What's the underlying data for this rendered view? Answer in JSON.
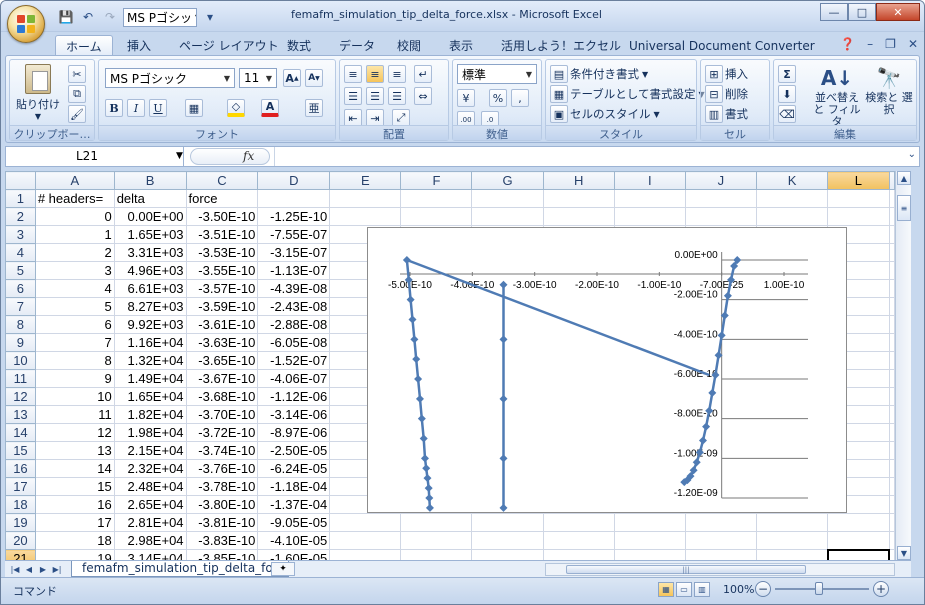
{
  "window": {
    "title": "femafm_simulation_tip_delta_force.xlsx - Microsoft Excel",
    "minimize": "—",
    "maximize": "□",
    "close": "✕"
  },
  "qat": {
    "font_value": "MS Pゴシッ"
  },
  "tabs": [
    "ホーム",
    "挿入",
    "ページ レイアウト",
    "数式",
    "データ",
    "校閲",
    "表示",
    "活用しよう！エクセル",
    "Universal Document Converter"
  ],
  "ribbon": {
    "clipboard": {
      "label": "クリップボー…",
      "paste": "貼り付け"
    },
    "font": {
      "label": "フォント",
      "name": "MS Pゴシック",
      "size": "11"
    },
    "alignment": {
      "label": "配置"
    },
    "number": {
      "label": "数値",
      "format": "標準",
      "percent": "%"
    },
    "styles": {
      "label": "スタイル",
      "conditional": "条件付き書式",
      "table": "テーブルとして書式設定",
      "cell_style": "セルのスタイル"
    },
    "cells": {
      "label": "セル",
      "insert": "挿入",
      "delete": "削除",
      "format": "書式"
    },
    "editing": {
      "label": "編集",
      "sort": "並べ替えと フィルタ",
      "find": "検索と 選択"
    }
  },
  "formula_bar": {
    "name_box": "L21",
    "fx": "fx",
    "content": ""
  },
  "sheet": {
    "columns": [
      "A",
      "B",
      "C",
      "D",
      "E",
      "F",
      "G",
      "H",
      "I",
      "J",
      "K",
      "L"
    ],
    "selected_column": "L",
    "selected_row": "21",
    "rows": [
      {
        "n": "1",
        "cells": [
          "# headers=",
          "delta",
          "force",
          ""
        ]
      },
      {
        "n": "2",
        "cells": [
          "0",
          "0.00E+00",
          "-3.50E-10",
          "-1.25E-10"
        ]
      },
      {
        "n": "3",
        "cells": [
          "1",
          "1.65E+03",
          "-3.51E-10",
          "-7.55E-07"
        ]
      },
      {
        "n": "4",
        "cells": [
          "2",
          "3.31E+03",
          "-3.53E-10",
          "-3.15E-07"
        ]
      },
      {
        "n": "5",
        "cells": [
          "3",
          "4.96E+03",
          "-3.55E-10",
          "-1.13E-07"
        ]
      },
      {
        "n": "6",
        "cells": [
          "4",
          "6.61E+03",
          "-3.57E-10",
          "-4.39E-08"
        ]
      },
      {
        "n": "7",
        "cells": [
          "5",
          "8.27E+03",
          "-3.59E-10",
          "-2.43E-08"
        ]
      },
      {
        "n": "8",
        "cells": [
          "6",
          "9.92E+03",
          "-3.61E-10",
          "-2.88E-08"
        ]
      },
      {
        "n": "9",
        "cells": [
          "7",
          "1.16E+04",
          "-3.63E-10",
          "-6.05E-08"
        ]
      },
      {
        "n": "10",
        "cells": [
          "8",
          "1.32E+04",
          "-3.65E-10",
          "-1.52E-07"
        ]
      },
      {
        "n": "11",
        "cells": [
          "9",
          "1.49E+04",
          "-3.67E-10",
          "-4.06E-07"
        ]
      },
      {
        "n": "12",
        "cells": [
          "10",
          "1.65E+04",
          "-3.68E-10",
          "-1.12E-06"
        ]
      },
      {
        "n": "13",
        "cells": [
          "11",
          "1.82E+04",
          "-3.70E-10",
          "-3.14E-06"
        ]
      },
      {
        "n": "14",
        "cells": [
          "12",
          "1.98E+04",
          "-3.72E-10",
          "-8.97E-06"
        ]
      },
      {
        "n": "15",
        "cells": [
          "13",
          "2.15E+04",
          "-3.74E-10",
          "-2.50E-05"
        ]
      },
      {
        "n": "16",
        "cells": [
          "14",
          "2.32E+04",
          "-3.76E-10",
          "-6.24E-05"
        ]
      },
      {
        "n": "17",
        "cells": [
          "15",
          "2.48E+04",
          "-3.78E-10",
          "-1.18E-04"
        ]
      },
      {
        "n": "18",
        "cells": [
          "16",
          "2.65E+04",
          "-3.80E-10",
          "-1.37E-04"
        ]
      },
      {
        "n": "19",
        "cells": [
          "17",
          "2.81E+04",
          "-3.81E-10",
          "-9.05E-05"
        ]
      },
      {
        "n": "20",
        "cells": [
          "18",
          "2.98E+04",
          "-3.83E-10",
          "-4.10E-05"
        ]
      },
      {
        "n": "21",
        "cells": [
          "19",
          "3.14E+04",
          "-3.85E-10",
          "-1.60E-05"
        ]
      }
    ]
  },
  "chart_data": {
    "type": "scatter",
    "x_ticks": [
      "-5.00E-10",
      "-4.00E-10",
      "-3.00E-10",
      "-2.00E-10",
      "-1.00E-10",
      "-7.00E-25",
      "1.00E-10"
    ],
    "y_ticks": [
      "0.00E+00",
      "-2.00E-10",
      "-4.00E-10",
      "-6.00E-10",
      "-8.00E-10",
      "-1.00E-09",
      "-1.20E-09"
    ],
    "xlim": [
      -5e-10,
      1e-10
    ],
    "ylim": [
      -1.2e-09,
      0
    ],
    "color": "#4f7bb4",
    "series": [
      {
        "markers": true,
        "x": [
          -5.05e-10,
          -5.02e-10,
          -4.99e-10,
          -4.96e-10,
          -4.93e-10,
          -4.9e-10,
          -4.87e-10,
          -4.84e-10,
          -4.81e-10,
          -4.78e-10,
          -4.76e-10,
          -4.74e-10,
          -4.72e-10,
          -4.7e-10,
          -4.69e-10,
          -4.68e-10
        ],
        "y": [
          0.0,
          -1e-10,
          -2e-10,
          -3e-10,
          -4e-10,
          -5e-10,
          -6e-10,
          -7e-10,
          -8e-10,
          -9e-10,
          -1e-09,
          -1.05e-09,
          -1.1e-09,
          -1.15e-09,
          -1.2e-09,
          -1.25e-09
        ]
      },
      {
        "markers": true,
        "x": [
          -6e-11,
          -5.5e-11,
          -5e-11,
          -4.5e-11,
          -4e-11,
          -3.5e-11,
          -3e-11,
          -2.5e-11,
          -2e-11,
          -1.5e-11,
          -1e-11,
          -5e-12,
          0.0,
          5e-12,
          1e-11,
          1.5e-11,
          2e-11,
          2.5e-11
        ],
        "y": [
          -1.12e-09,
          -1.11e-09,
          -1.09e-09,
          -1.06e-09,
          -1.02e-09,
          -9.7e-10,
          -9.1e-10,
          -8.4e-10,
          -7.6e-10,
          -6.7e-10,
          -5.8e-10,
          -4.8e-10,
          -3.8e-10,
          -2.8e-10,
          -1.8e-10,
          -1e-10,
          -3e-11,
          0.0
        ]
      },
      {
        "markers": false,
        "x": [
          -5.05e-10,
          -2e-11
        ],
        "y": [
          0.0,
          -5.8e-10
        ]
      },
      {
        "markers": true,
        "x": [
          -3.5e-10,
          -3.5e-10,
          -3.5e-10,
          -3.5e-10,
          -3.5e-10
        ],
        "y": [
          -1.25e-10,
          -4e-10,
          -7e-10,
          -1e-09,
          -1.25e-09
        ]
      }
    ]
  },
  "sheet_tab": "femafm_simulation_tip_delta_for",
  "status": {
    "mode": "コマンド",
    "zoom": "100%"
  }
}
